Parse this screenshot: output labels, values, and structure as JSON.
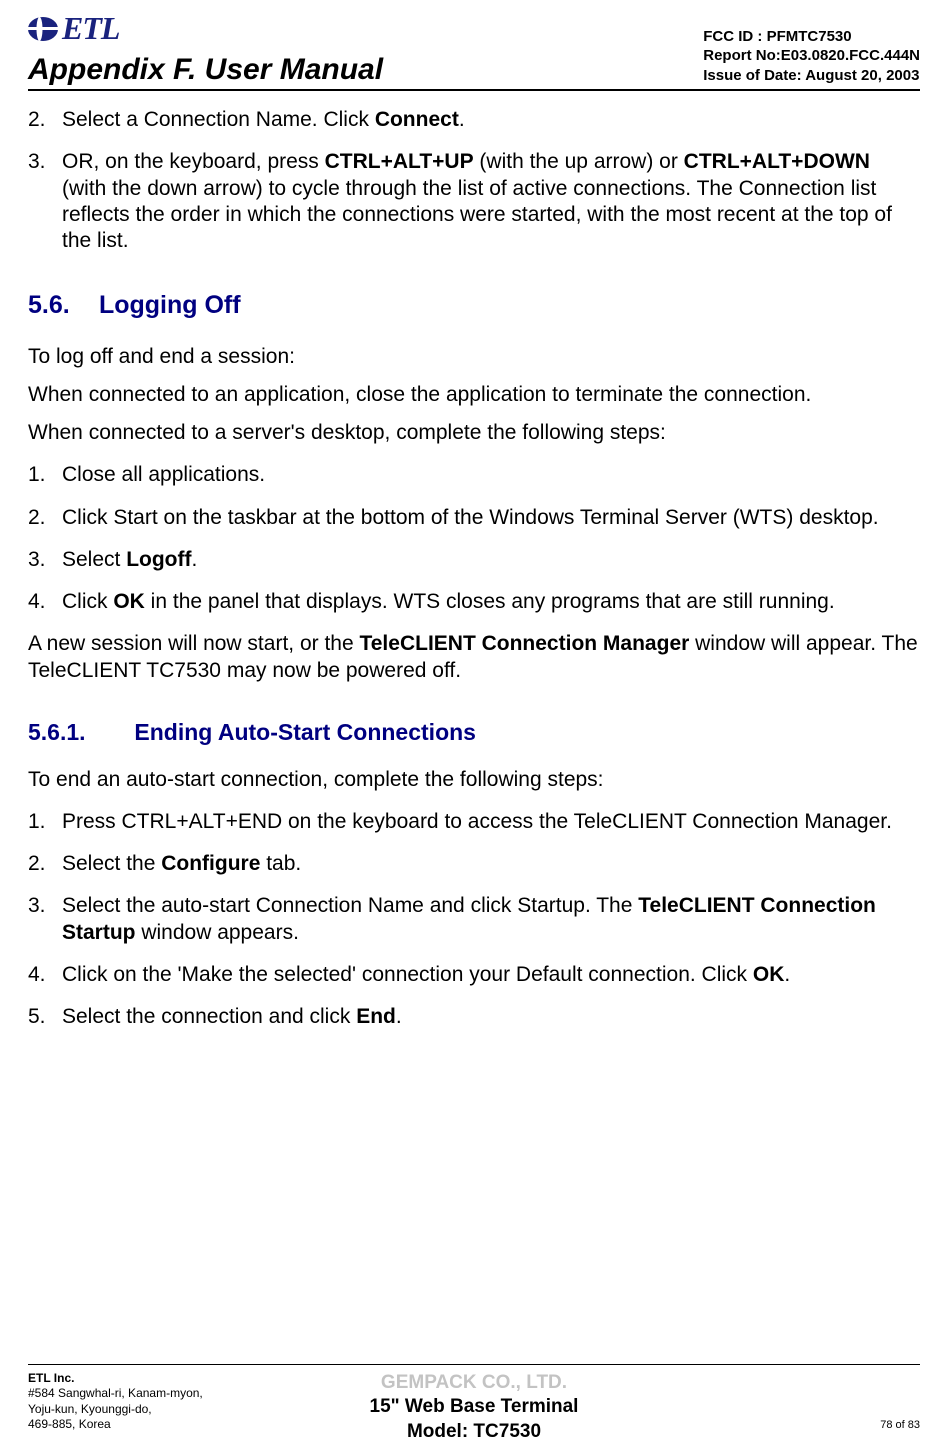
{
  "header": {
    "logo_text": "ETL",
    "appendix": "Appendix F. User Manual",
    "fcc": "FCC ID : PFMTC7530",
    "report": "Report No:E03.0820.FCC.444N",
    "issue": "Issue of Date:  August 20, 2003"
  },
  "step2_pre": "Select a Connection Name.  Click ",
  "step2_bold": "Connect",
  "step2_post": ".",
  "step3_pre": "OR, on the keyboard, press ",
  "step3_b1": "CTRL+ALT+UP",
  "step3_mid1": " (with the up arrow) or ",
  "step3_b2": "CTRL+ALT+DOWN",
  "step3_post": " (with the down arrow) to cycle through the list of active connections. The Connection list reflects the order in which the connections were started, with the most recent at the top of the list.",
  "s56_num": "5.6.",
  "s56_title": "Logging Off",
  "s56_p1": "To log off and end a session:",
  "s56_p2": "When connected to an application, close the application to terminate the connection.",
  "s56_p3": "When connected to a server's desktop, complete the following steps:",
  "s56_li1": "Close all applications.",
  "s56_li2": "Click Start on the taskbar at the bottom of the Windows Terminal Server (WTS) desktop.",
  "s56_li3_pre": "Select ",
  "s56_li3_b": "Logoff",
  "s56_li3_post": ".",
  "s56_li4_pre": "Click ",
  "s56_li4_b": "OK",
  "s56_li4_post": " in the panel that displays. WTS closes any programs that are still running.",
  "s56_p4_pre": "A new session will now start, or the ",
  "s56_p4_b": "TeleCLIENT Connection Manager",
  "s56_p4_post": " window will appear.  The TeleCLIENT TC7530 may now be powered off.",
  "s561_num": "5.6.1.",
  "s561_title": "Ending Auto-Start Connections",
  "s561_p1": "To end an auto-start connection, complete the following steps:",
  "s561_li1": "Press CTRL+ALT+END on the keyboard to access the TeleCLIENT Connection Manager.",
  "s561_li2_pre": "Select the ",
  "s561_li2_b": "Configure",
  "s561_li2_post": " tab.",
  "s561_li3_pre": "Select the auto-start Connection Name and click Startup.  The ",
  "s561_li3_b": "TeleCLIENT Connection Startup",
  "s561_li3_post": " window appears.",
  "s561_li4_pre": "Click on the 'Make the selected'  connection your Default connection.  Click ",
  "s561_li4_b": "OK",
  "s561_li4_post": ".",
  "s561_li5_pre": "Select the connection and click ",
  "s561_li5_b": "End",
  "s561_li5_post": ".",
  "footer": {
    "company": "ETL Inc.",
    "addr1": "#584 Sangwhal-ri, Kanam-myon,",
    "addr2": "Yoju-kun, Kyounggi-do,",
    "addr3": "469-885, Korea",
    "gempack": "GEMPACK CO., LTD.",
    "terminal": "15\" Web Base Terminal",
    "model": "Model: TC7530",
    "page": "78 of  83"
  },
  "n2": "2.",
  "n3": "3.",
  "n1": "1.",
  "n4": "4.",
  "n5": "5."
}
